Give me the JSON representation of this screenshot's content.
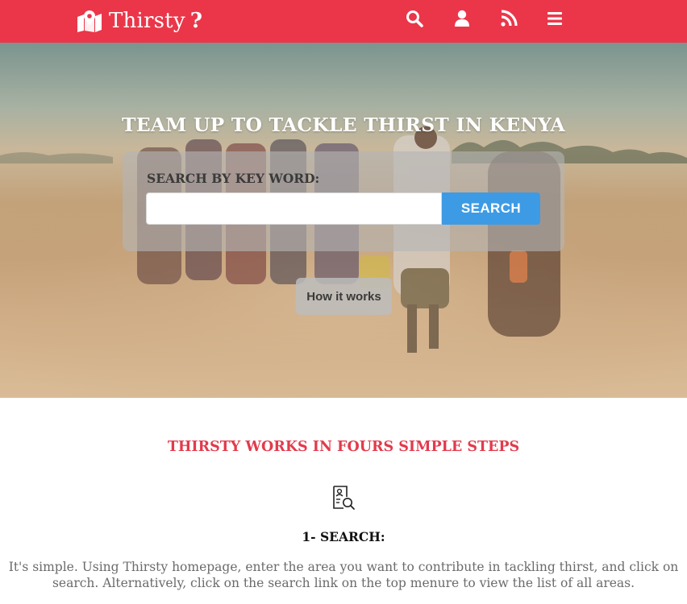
{
  "brand": {
    "name": "Thirsty",
    "mark": "?",
    "icon": "map-marker-icon"
  },
  "nav": {
    "icons": [
      "search-icon",
      "user-icon",
      "rss-icon",
      "menu-icon"
    ]
  },
  "hero": {
    "title": "TEAM UP TO TACKLE THIRST IN KENYA",
    "search_label": "SEARCH BY KEY WORD:",
    "search_input_value": "",
    "search_button": "SEARCH",
    "how_button": "How it works"
  },
  "steps": {
    "title": "THIRSTY WORKS IN FOURS SIMPLE STEPS",
    "items": [
      {
        "icon": "document-search-icon",
        "heading": "1- SEARCH:",
        "text": "It's simple. Using Thirsty homepage, enter the area you want to contribute in tackling thirst, and click on search. Alternatively, click on the search link on the top menure to view the list of all areas."
      }
    ]
  },
  "colors": {
    "primary": "#eb3649",
    "accent": "#3d9be5",
    "heading_red": "#e23b4c"
  }
}
